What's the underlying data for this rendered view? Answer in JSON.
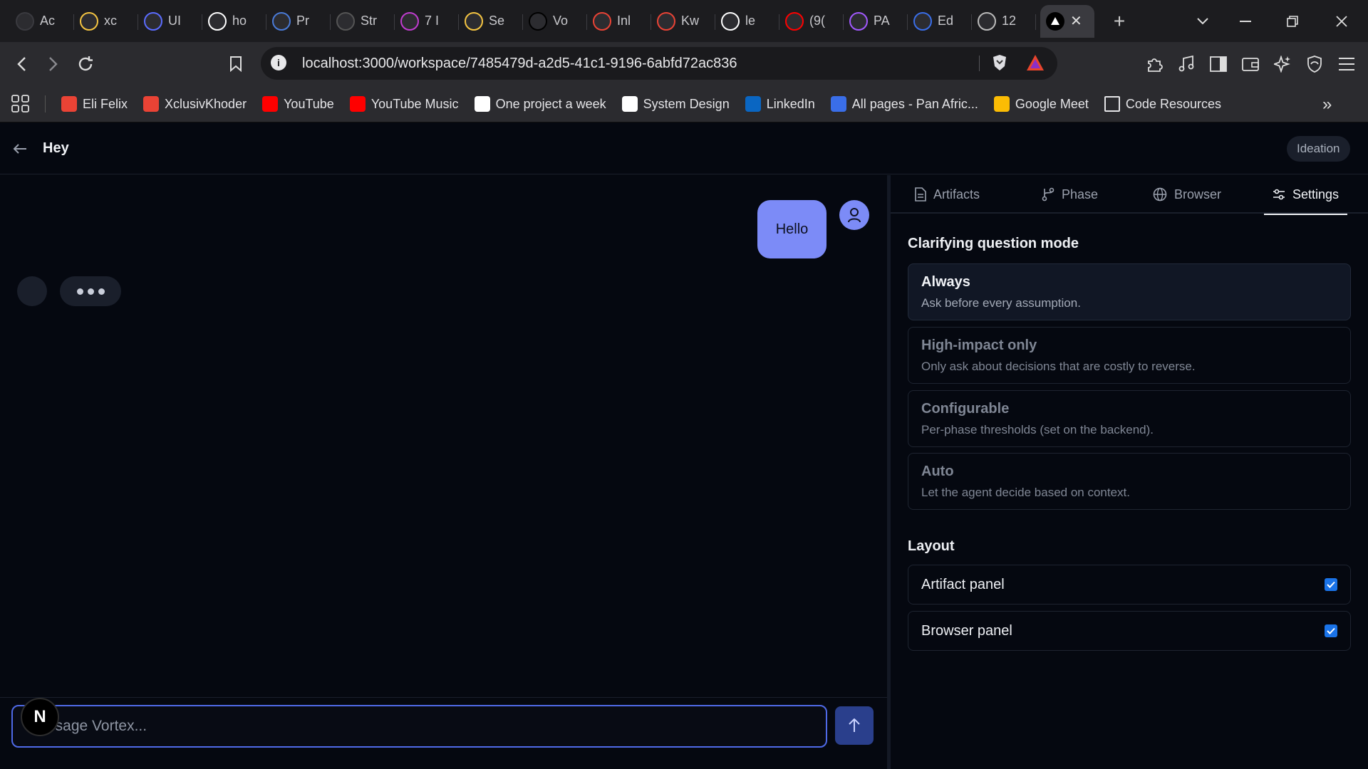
{
  "browser": {
    "tabs": [
      {
        "label": "Ac",
        "icon": "lightning-icon",
        "color": "#3a3a3f"
      },
      {
        "label": "xc",
        "icon": "smiley-icon",
        "color": "#f5c542"
      },
      {
        "label": "UI",
        "icon": "target-icon",
        "color": "#5b6cff"
      },
      {
        "label": "ho",
        "icon": "google-icon",
        "color": "#ffffff"
      },
      {
        "label": "Pr",
        "icon": "rainbow-icon",
        "color": "#4a7bd8"
      },
      {
        "label": "Str",
        "icon": "crown-icon",
        "color": "#555555"
      },
      {
        "label": "7 I",
        "icon": "stack-icon",
        "color": "#c03ccf"
      },
      {
        "label": "Se",
        "icon": "emoji-icon",
        "color": "#f5c542"
      },
      {
        "label": "Vo",
        "icon": "triangle-icon",
        "color": "#000000"
      },
      {
        "label": "Inl",
        "icon": "gmail-icon",
        "color": "#ea4335"
      },
      {
        "label": "Kw",
        "icon": "gmail-icon",
        "color": "#ea4335"
      },
      {
        "label": "le",
        "icon": "github-icon",
        "color": "#ffffff"
      },
      {
        "label": "(9(",
        "icon": "youtube-icon",
        "color": "#ff0000"
      },
      {
        "label": "PA",
        "icon": "figma-icon",
        "color": "#a259ff"
      },
      {
        "label": "Ed",
        "icon": "shield-icon",
        "color": "#3a6ee8"
      },
      {
        "label": "12",
        "icon": "globe-icon",
        "color": "#bbbbbb"
      }
    ],
    "url": "localhost:3000/workspace/7485479d-a2d5-41c1-9196-6abfd72ac836",
    "bookmarks": [
      {
        "label": "Eli Felix",
        "icon": "gmail-icon",
        "color": "#ea4335"
      },
      {
        "label": "XclusivKhoder",
        "icon": "gmail-icon",
        "color": "#ea4335"
      },
      {
        "label": "YouTube",
        "icon": "youtube-icon",
        "color": "#ff0000"
      },
      {
        "label": "YouTube Music",
        "icon": "youtube-music-icon",
        "color": "#ff0000"
      },
      {
        "label": "One project a week",
        "icon": "github-icon",
        "color": "#ffffff"
      },
      {
        "label": "System Design",
        "icon": "github-icon",
        "color": "#ffffff"
      },
      {
        "label": "LinkedIn",
        "icon": "linkedin-icon",
        "color": "#0a66c2"
      },
      {
        "label": "All pages - Pan Afric...",
        "icon": "shield-icon",
        "color": "#3a6ee8"
      },
      {
        "label": "Google Meet",
        "icon": "meet-icon",
        "color": "#fbbc04"
      },
      {
        "label": "Code Resources",
        "icon": "folder-icon",
        "color": "#e4e4e7"
      }
    ]
  },
  "app": {
    "title": "Hey",
    "phase_badge": "Ideation",
    "chat": {
      "user_message": "Hello",
      "composer_placeholder": "Message Vortex...",
      "n_badge": "N"
    },
    "panel": {
      "tabs": [
        {
          "label": "Artifacts",
          "icon": "document-icon"
        },
        {
          "label": "Phase",
          "icon": "branch-icon"
        },
        {
          "label": "Browser",
          "icon": "globe-icon"
        },
        {
          "label": "Settings",
          "icon": "sliders-icon",
          "active": true
        }
      ],
      "clarifying_title": "Clarifying question mode",
      "options": [
        {
          "title": "Always",
          "desc": "Ask before every assumption.",
          "selected": true
        },
        {
          "title": "High-impact only",
          "desc": "Only ask about decisions that are costly to reverse."
        },
        {
          "title": "Configurable",
          "desc": "Per-phase thresholds (set on the backend)."
        },
        {
          "title": "Auto",
          "desc": "Let the agent decide based on context."
        }
      ],
      "layout_title": "Layout",
      "toggles": [
        {
          "label": "Artifact panel",
          "checked": true
        },
        {
          "label": "Browser panel",
          "checked": true
        }
      ]
    }
  },
  "colors": {
    "accent": "#7c8bf7",
    "composer_border": "#4f6ae8",
    "send_button": "#2a3f8c",
    "checkbox": "#1a73e8"
  }
}
